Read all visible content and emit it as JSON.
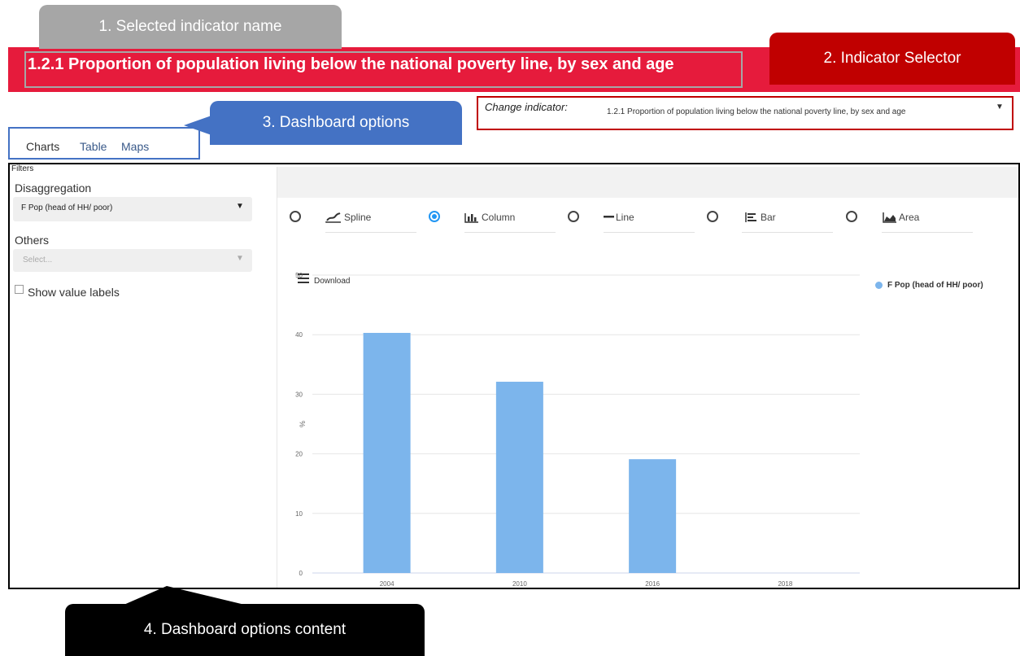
{
  "callouts": {
    "c1": "1.    Selected indicator name",
    "c2": "2.    Indicator Selector",
    "c3": "3.    Dashboard options",
    "c4": "4.    Dashboard options content"
  },
  "header": {
    "indicator_title": "1.2.1 Proportion of population living below the national poverty line, by sex and age"
  },
  "selector": {
    "label": "Change indicator:",
    "value": "1.2.1 Proportion of population living below the national poverty line, by sex and age"
  },
  "tabs": [
    {
      "label": "Charts",
      "active": true
    },
    {
      "label": "Table",
      "active": false
    },
    {
      "label": "Maps",
      "active": false
    }
  ],
  "filters": {
    "heading": "Filters",
    "disaggregation_label": "Disaggregation",
    "disaggregation_value": "F Pop (head of HH/ poor)",
    "others_label": "Others",
    "others_placeholder": "Select...",
    "show_value_labels": "Show value labels",
    "show_value_labels_checked": false
  },
  "chart_types": [
    {
      "label": "Spline",
      "selected": false,
      "icon": "spline-chart-icon"
    },
    {
      "label": "Column",
      "selected": true,
      "icon": "column-chart-icon"
    },
    {
      "label": "Line",
      "selected": false,
      "icon": "line-chart-icon"
    },
    {
      "label": "Bar",
      "selected": false,
      "icon": "bar-chart-icon"
    },
    {
      "label": "Area",
      "selected": false,
      "icon": "area-chart-icon"
    }
  ],
  "chart_menu": {
    "download_label": "Download"
  },
  "chart_data": {
    "type": "bar",
    "categories": [
      "2004",
      "2010",
      "2016",
      "2018"
    ],
    "series": [
      {
        "name": "F Pop (head of HH/ poor)",
        "values": [
          40.3,
          32.1,
          19.1,
          null
        ],
        "color": "#7cb5ec"
      }
    ],
    "ylabel": "%",
    "ylim": [
      0,
      50
    ],
    "yticks": [
      "0",
      "10",
      "20",
      "30",
      "40",
      "50"
    ],
    "grid": true,
    "legend_position": "right"
  },
  "colors": {
    "banner": "#e61b3c",
    "callout_grey": "#a6a6a6",
    "callout_red": "#c00000",
    "callout_blue": "#4472c4",
    "callout_black": "#000000",
    "bar": "#7cb5ec",
    "radio_selected": "#2196f3"
  }
}
